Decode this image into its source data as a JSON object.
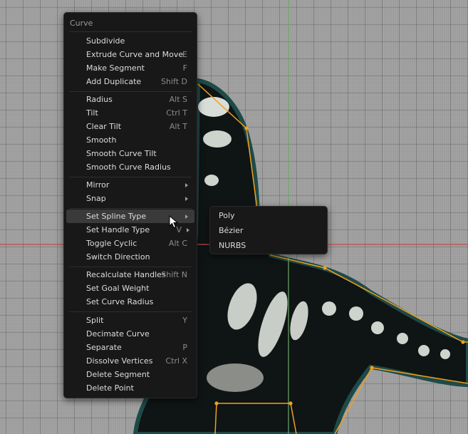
{
  "colors": {
    "menu_bg": "#181818",
    "highlight": "#3a3a3a",
    "curve": "#f0a020",
    "x_axis": "#c84a4a",
    "y_axis": "#6aa86a"
  },
  "menu": {
    "title": "Curve",
    "groups": [
      [
        {
          "label": "Subdivide",
          "shortcut": ""
        },
        {
          "label": "Extrude Curve and Move",
          "shortcut": "E"
        },
        {
          "label": "Make Segment",
          "shortcut": "F"
        },
        {
          "label": "Add Duplicate",
          "shortcut": "Shift D"
        }
      ],
      [
        {
          "label": "Radius",
          "shortcut": "Alt S"
        },
        {
          "label": "Tilt",
          "shortcut": "Ctrl T"
        },
        {
          "label": "Clear Tilt",
          "shortcut": "Alt T"
        },
        {
          "label": "Smooth",
          "shortcut": ""
        },
        {
          "label": "Smooth Curve Tilt",
          "shortcut": ""
        },
        {
          "label": "Smooth Curve Radius",
          "shortcut": ""
        }
      ],
      [
        {
          "label": "Mirror",
          "shortcut": "",
          "submenu": true
        },
        {
          "label": "Snap",
          "shortcut": "",
          "submenu": true
        }
      ],
      [
        {
          "label": "Set Spline Type",
          "shortcut": "",
          "submenu": true,
          "active": true
        },
        {
          "label": "Set Handle Type",
          "shortcut": "V",
          "submenu": true
        },
        {
          "label": "Toggle Cyclic",
          "shortcut": "Alt C"
        },
        {
          "label": "Switch Direction",
          "shortcut": ""
        }
      ],
      [
        {
          "label": "Recalculate Handles",
          "shortcut": "Shift N"
        },
        {
          "label": "Set Goal Weight",
          "shortcut": ""
        },
        {
          "label": "Set Curve Radius",
          "shortcut": ""
        }
      ],
      [
        {
          "label": "Split",
          "shortcut": "Y"
        },
        {
          "label": "Decimate Curve",
          "shortcut": ""
        },
        {
          "label": "Separate",
          "shortcut": "P"
        },
        {
          "label": "Dissolve Vertices",
          "shortcut": "Ctrl X"
        },
        {
          "label": "Delete Segment",
          "shortcut": ""
        },
        {
          "label": "Delete Point",
          "shortcut": ""
        }
      ]
    ]
  },
  "submenu": {
    "items": [
      {
        "label": "Poly"
      },
      {
        "label": "Bézier"
      },
      {
        "label": "NURBS"
      }
    ]
  }
}
